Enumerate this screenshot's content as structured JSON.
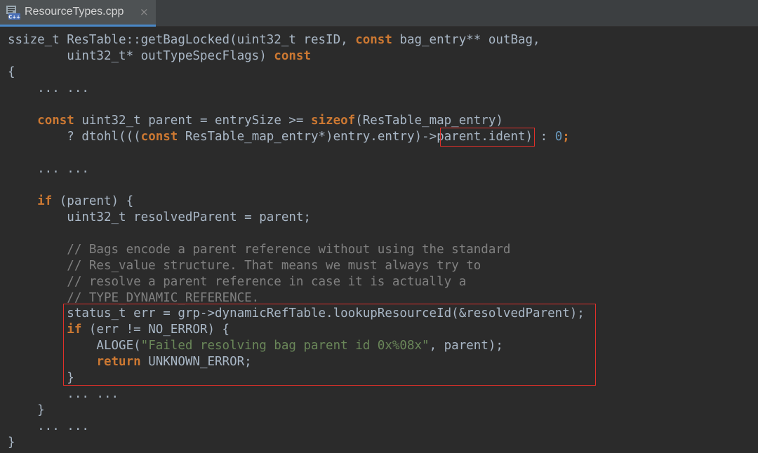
{
  "tab": {
    "icon_text": "C++",
    "title": "ResourceTypes.cpp",
    "close_glyph": "×"
  },
  "colors": {
    "background": "#2b2b2b",
    "default_text": "#a9b7c6",
    "keyword": "#cc7832",
    "number": "#6897bb",
    "string": "#6a8759",
    "comment": "#808080",
    "highlight_box": "#e0302a"
  },
  "code": {
    "l1": {
      "a": "ssize_t ResTable::getBagLocked(uint32_t resID, ",
      "k1": "const",
      "b": " bag_entry** outBag,"
    },
    "l2": {
      "a": "        uint32_t* outTypeSpecFlags) ",
      "k1": "const"
    },
    "l3": {
      "a": "{"
    },
    "l4": {
      "a": "    ... ..."
    },
    "l6": {
      "ind": "    ",
      "k1": "const",
      "a": " uint32_t parent = entrySize >= ",
      "k2": "sizeof",
      "b": "(ResTable_map_entry)"
    },
    "l7": {
      "a": "        ? dtohl(((",
      "k1": "const",
      "b": " ResTable_map_entry*)entry.entry)->",
      "c": "parent.ident",
      "d": ") : ",
      "n": "0",
      "e": ";"
    },
    "l9": {
      "a": "    ... ..."
    },
    "l11": {
      "ind": "    ",
      "k1": "if",
      "a": " (parent) {"
    },
    "l12": {
      "a": "        uint32_t resolvedParent = parent;"
    },
    "l14": {
      "a": "        // Bags encode a parent reference without using the standard"
    },
    "l15": {
      "a": "        // Res_value structure. That means we must always try to"
    },
    "l16": {
      "a": "        // resolve a parent reference in case it is actually a"
    },
    "l17": {
      "a": "        // TYPE_DYNAMIC_REFERENCE."
    },
    "l18": {
      "a": "        status_t err = grp->dynamicRefTable.lookupResourceId(&resolvedParent);"
    },
    "l19": {
      "ind": "        ",
      "k1": "if",
      "a": " (err != NO_ERROR) {"
    },
    "l20": {
      "a": "            ALOGE(",
      "s": "\"Failed resolving bag parent id 0x%08x\"",
      "b": ", parent);"
    },
    "l21": {
      "ind": "            ",
      "k1": "return",
      "a": " UNKNOWN_ERROR;"
    },
    "l22": {
      "a": "        }"
    },
    "l23": {
      "a": "        ... ..."
    },
    "l24": {
      "a": "    }"
    },
    "l25": {
      "a": "    ... ..."
    },
    "l26": {
      "a": "}"
    }
  }
}
